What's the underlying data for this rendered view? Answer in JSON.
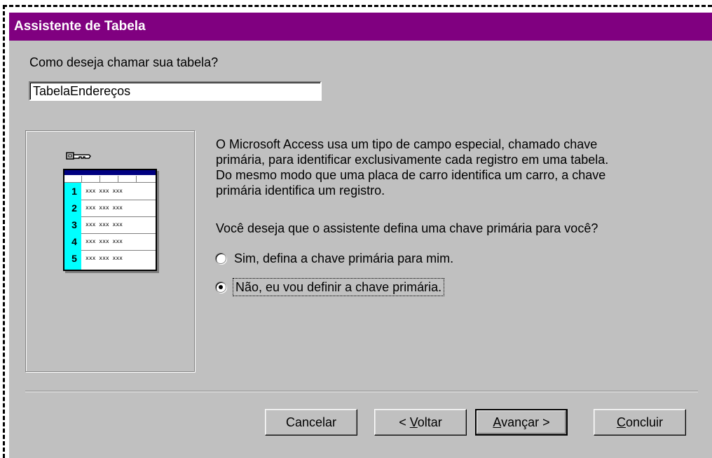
{
  "window": {
    "title": "Assistente de Tabela"
  },
  "table_name": {
    "prompt": "Como deseja chamar sua tabela?",
    "value": "TabelaEndereços"
  },
  "illustration": {
    "icons": [
      "key-icon",
      "table-icon"
    ],
    "rows": [
      {
        "num": "1",
        "data": "xxx xxx xxx"
      },
      {
        "num": "2",
        "data": "xxx xxx xxx"
      },
      {
        "num": "3",
        "data": "xxx xxx xxx"
      },
      {
        "num": "4",
        "data": "xxx xxx xxx"
      },
      {
        "num": "5",
        "data": "xxx xxx xxx"
      }
    ]
  },
  "description": {
    "line1": "O Microsoft Access usa um tipo de campo especial, chamado chave",
    "line2": "primária, para identificar exclusivamente cada registro em uma tabela.",
    "line3": "Do mesmo modo que uma placa de carro identifica um carro, a chave",
    "line4": "primária identifica um registro."
  },
  "question": "Você deseja que o assistente defina uma chave primária para você?",
  "options": [
    {
      "label": "Sim, defina a chave primária para mim.",
      "selected": false
    },
    {
      "label": "Não, eu vou definir a chave primária.",
      "selected": true
    }
  ],
  "buttons": {
    "cancel": "Cancelar",
    "back_prefix": "< ",
    "back_mnemonic": "V",
    "back_rest": "oltar",
    "next_mnemonic": "A",
    "next_rest": "vançar >",
    "finish_mnemonic": "C",
    "finish_rest": "oncluir"
  },
  "colors": {
    "titlebar": "#800080",
    "dialog_bg": "#c0c0c0",
    "table_key_column": "#00ffff",
    "table_header": "#000080"
  }
}
